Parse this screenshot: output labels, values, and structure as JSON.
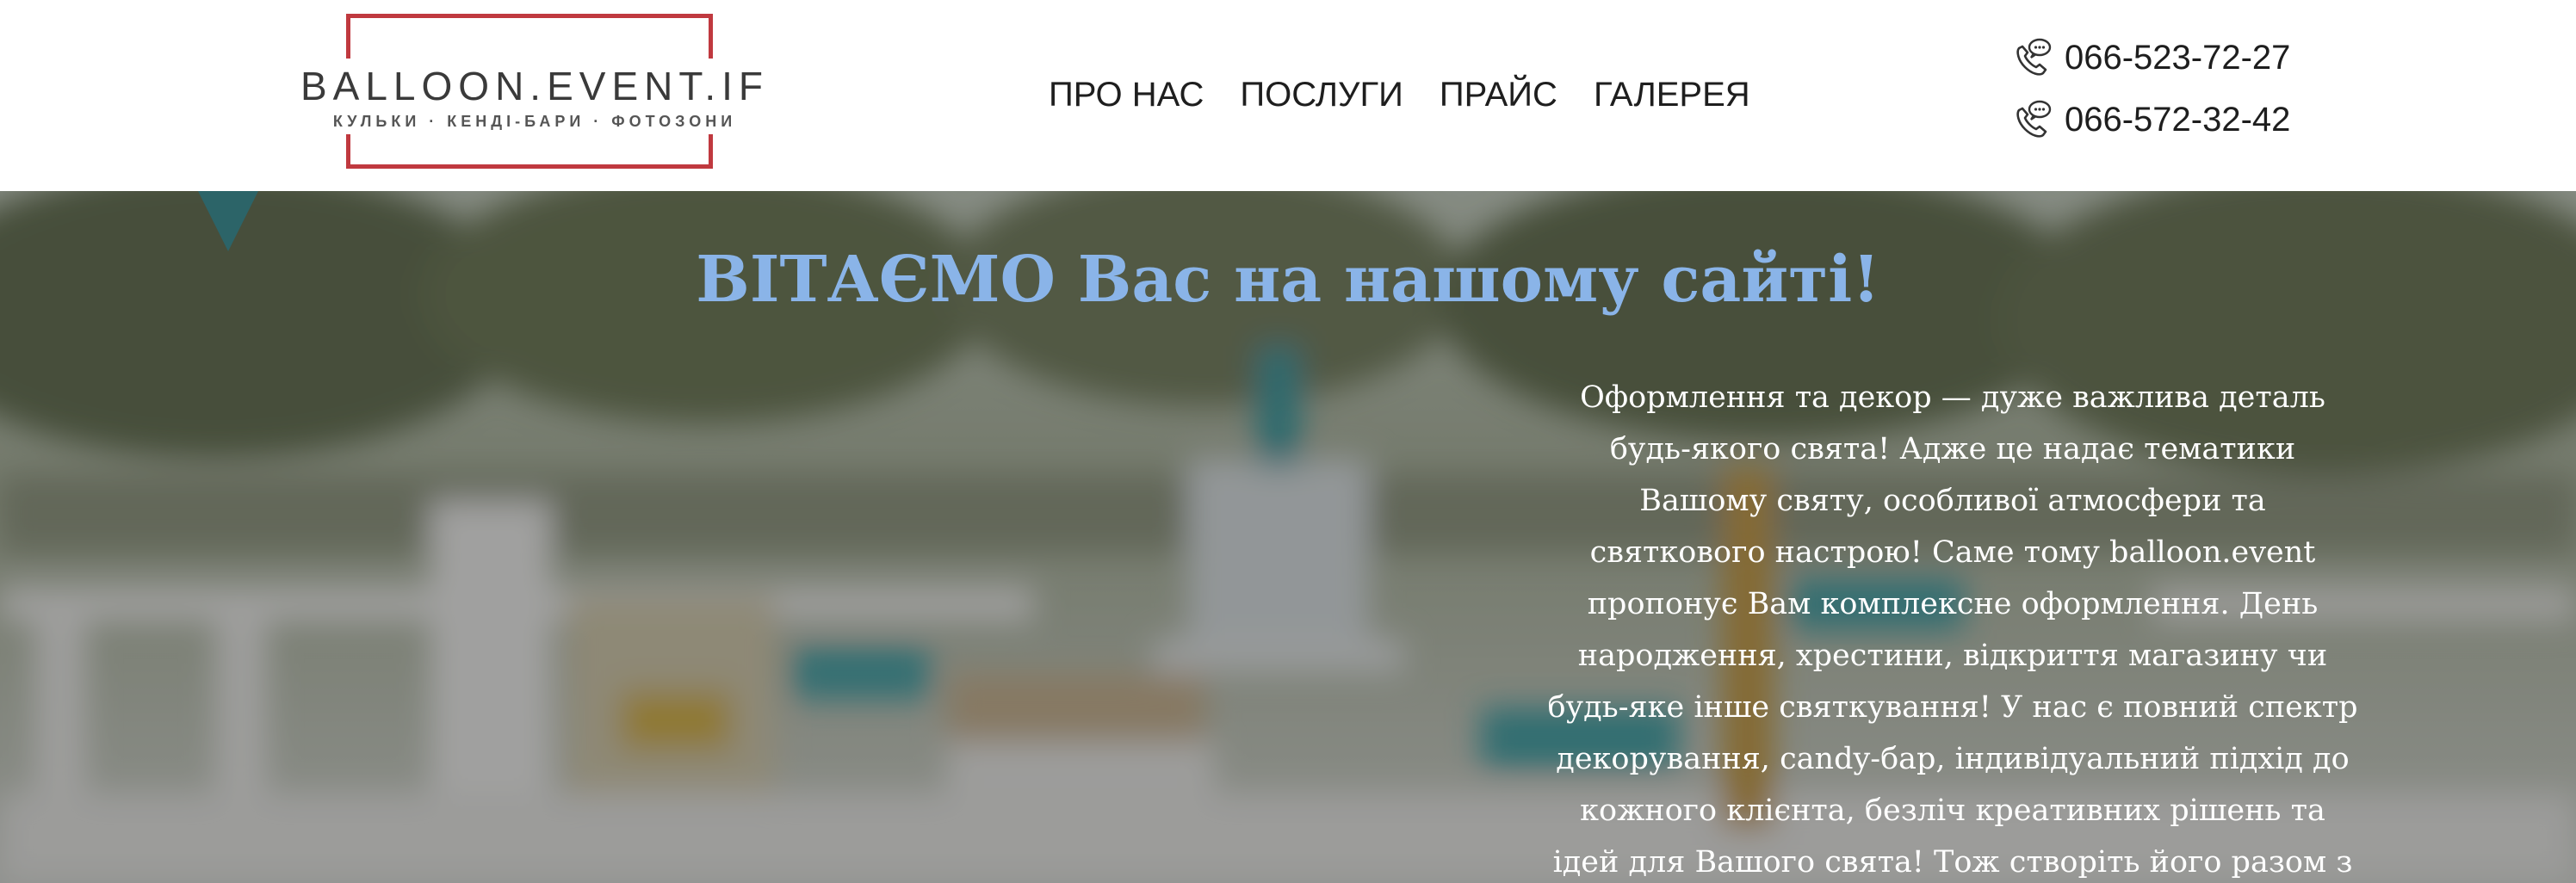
{
  "header": {
    "logo": {
      "title": "BALLOON.EVENT.IF",
      "subtitle": "КУЛЬКИ · КЕНДІ-БАРИ · ФОТОЗОНИ",
      "frame_color": "#c0393f"
    },
    "nav": {
      "items": [
        {
          "label": "ПРО НАС"
        },
        {
          "label": "ПОСЛУГИ"
        },
        {
          "label": "ПРАЙС"
        },
        {
          "label": "ГАЛЕРЕЯ"
        }
      ]
    },
    "phones": [
      {
        "number": "066-523-72-27",
        "icon": "phone-chat-icon"
      },
      {
        "number": "066-572-32-42",
        "icon": "phone-chat-icon"
      }
    ]
  },
  "hero": {
    "title": "ВІТАЄМО Вас на нашому сайті!",
    "title_color": "#8ab4e8",
    "body_lines": [
      "Оформлення та декор — дуже важлива деталь",
      "будь-якого свята! Адже це надає тематики",
      "Вашому святу, особливої атмосфери та",
      "святкового настрою! Саме тому balloon.event",
      "пропонує Вам комплексне оформлення. День",
      "народження, хрестини, відкриття магазину чи",
      "будь-яке інше святкування! У нас є повний спектр",
      "декорування, candy-бар, індивідуальний підхід до",
      "кожного клієнта, безліч креативних рішень та",
      "ідей для Вашого свята! Тож створіть його разом з"
    ],
    "background": "blurred-party-candy-bar-photo"
  }
}
